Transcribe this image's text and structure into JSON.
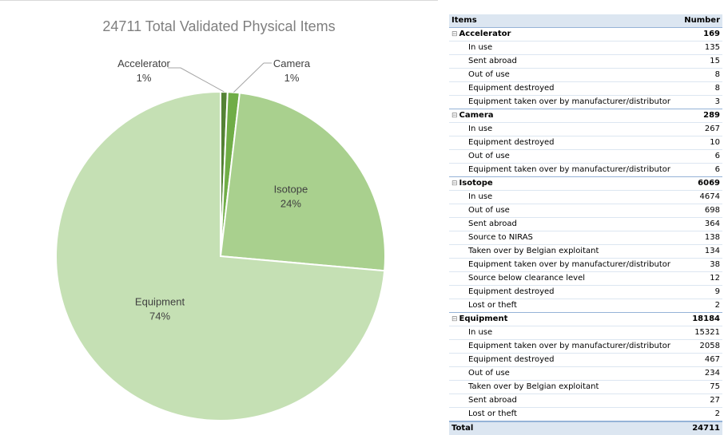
{
  "chart_data": {
    "type": "pie",
    "title": "24711 Total Validated Physical Items",
    "slices": [
      {
        "name": "Accelerator",
        "value": 169,
        "label_pct": "1%",
        "color": "#548235"
      },
      {
        "name": "Camera",
        "value": 289,
        "label_pct": "1%",
        "color": "#70ad47"
      },
      {
        "name": "Isotope",
        "value": 6069,
        "label_pct": "24%",
        "color": "#a9d08e"
      },
      {
        "name": "Equipment",
        "value": 18184,
        "label_pct": "74%",
        "color": "#c5e0b4"
      }
    ]
  },
  "table": {
    "header_items": "Items",
    "header_number": "Number",
    "groups": [
      {
        "name": "Accelerator",
        "total": "169",
        "rows": [
          {
            "label": "In use",
            "value": "135"
          },
          {
            "label": "Sent abroad",
            "value": "15"
          },
          {
            "label": "Out of use",
            "value": "8"
          },
          {
            "label": "Equipment destroyed",
            "value": "8"
          },
          {
            "label": "Equipment taken over by manufacturer/distributor",
            "value": "3"
          }
        ]
      },
      {
        "name": "Camera",
        "total": "289",
        "rows": [
          {
            "label": "In use",
            "value": "267"
          },
          {
            "label": "Equipment destroyed",
            "value": "10"
          },
          {
            "label": "Out of use",
            "value": "6"
          },
          {
            "label": "Equipment taken over by manufacturer/distributor",
            "value": "6"
          }
        ]
      },
      {
        "name": "Isotope",
        "total": "6069",
        "rows": [
          {
            "label": "In use",
            "value": "4674"
          },
          {
            "label": "Out of use",
            "value": "698"
          },
          {
            "label": "Sent abroad",
            "value": "364"
          },
          {
            "label": "Source to NIRAS",
            "value": "138"
          },
          {
            "label": "Taken over by Belgian exploitant",
            "value": "134"
          },
          {
            "label": "Equipment taken over by manufacturer/distributor",
            "value": "38"
          },
          {
            "label": "Source below clearance level",
            "value": "12"
          },
          {
            "label": "Equipment destroyed",
            "value": "9"
          },
          {
            "label": "Lost or theft",
            "value": "2"
          }
        ]
      },
      {
        "name": "Equipment",
        "total": "18184",
        "rows": [
          {
            "label": "In use",
            "value": "15321"
          },
          {
            "label": "Equipment taken over by manufacturer/distributor",
            "value": "2058"
          },
          {
            "label": "Equipment destroyed",
            "value": "467"
          },
          {
            "label": "Out of use",
            "value": "234"
          },
          {
            "label": "Taken over by Belgian exploitant",
            "value": "75"
          },
          {
            "label": "Sent abroad",
            "value": "27"
          },
          {
            "label": "Lost or theft",
            "value": "2"
          }
        ]
      }
    ],
    "total_label": "Total",
    "total_value": "24711"
  }
}
